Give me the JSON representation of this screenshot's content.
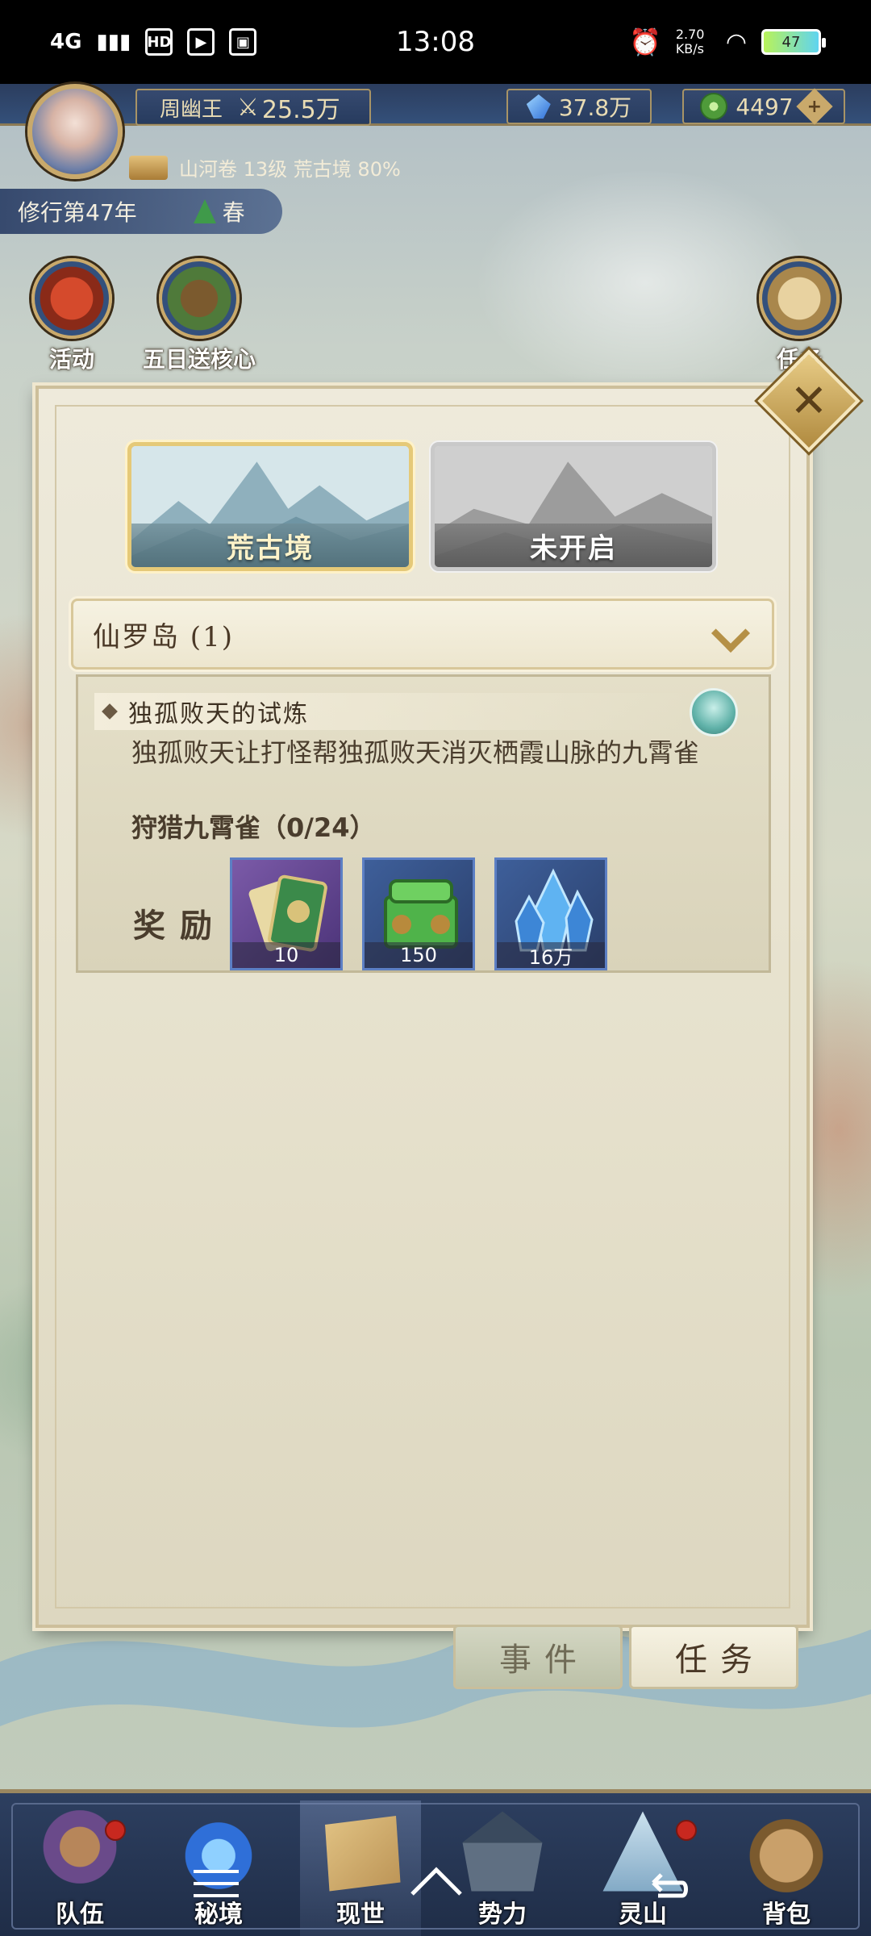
{
  "status_bar": {
    "network": "4G",
    "hd": "HD",
    "time": "13:08",
    "speed": "2.70 KB/s",
    "battery": "47"
  },
  "header": {
    "player_name": "周幽王",
    "power": "25.5万",
    "gems": "37.8万",
    "jade": "4497",
    "sub_info": "山河卷 13级 荒古境 80%",
    "year": "修行第47年",
    "season": "春"
  },
  "quick_buttons": {
    "activity": "活动",
    "five_day": "五日送核心",
    "tasks": "任务"
  },
  "dialog": {
    "tabs": [
      {
        "label": "荒古境",
        "state": "active"
      },
      {
        "label": "未开启",
        "state": "locked"
      }
    ],
    "region": "仙罗岛 (1)",
    "quest": {
      "title": "独孤败天的试炼",
      "description": "独孤败天让打怪帮独孤败天消灭栖霞山脉的九霄雀",
      "progress": "狩猎九霄雀（0/24）",
      "reward_label": "奖励",
      "rewards": [
        {
          "icon": "book-icon",
          "count": "10"
        },
        {
          "icon": "jade-chest-icon",
          "count": "150"
        },
        {
          "icon": "crystal-icon",
          "count": "16万"
        }
      ]
    },
    "bottom_tabs": {
      "events": "事件",
      "tasks": "任务"
    }
  },
  "bottom_nav": [
    {
      "label": "队伍",
      "badge": true
    },
    {
      "label": "秘境",
      "badge": false
    },
    {
      "label": "现世",
      "badge": false,
      "current": true
    },
    {
      "label": "势力",
      "badge": false
    },
    {
      "label": "灵山",
      "badge": true
    },
    {
      "label": "背包",
      "badge": false
    }
  ]
}
